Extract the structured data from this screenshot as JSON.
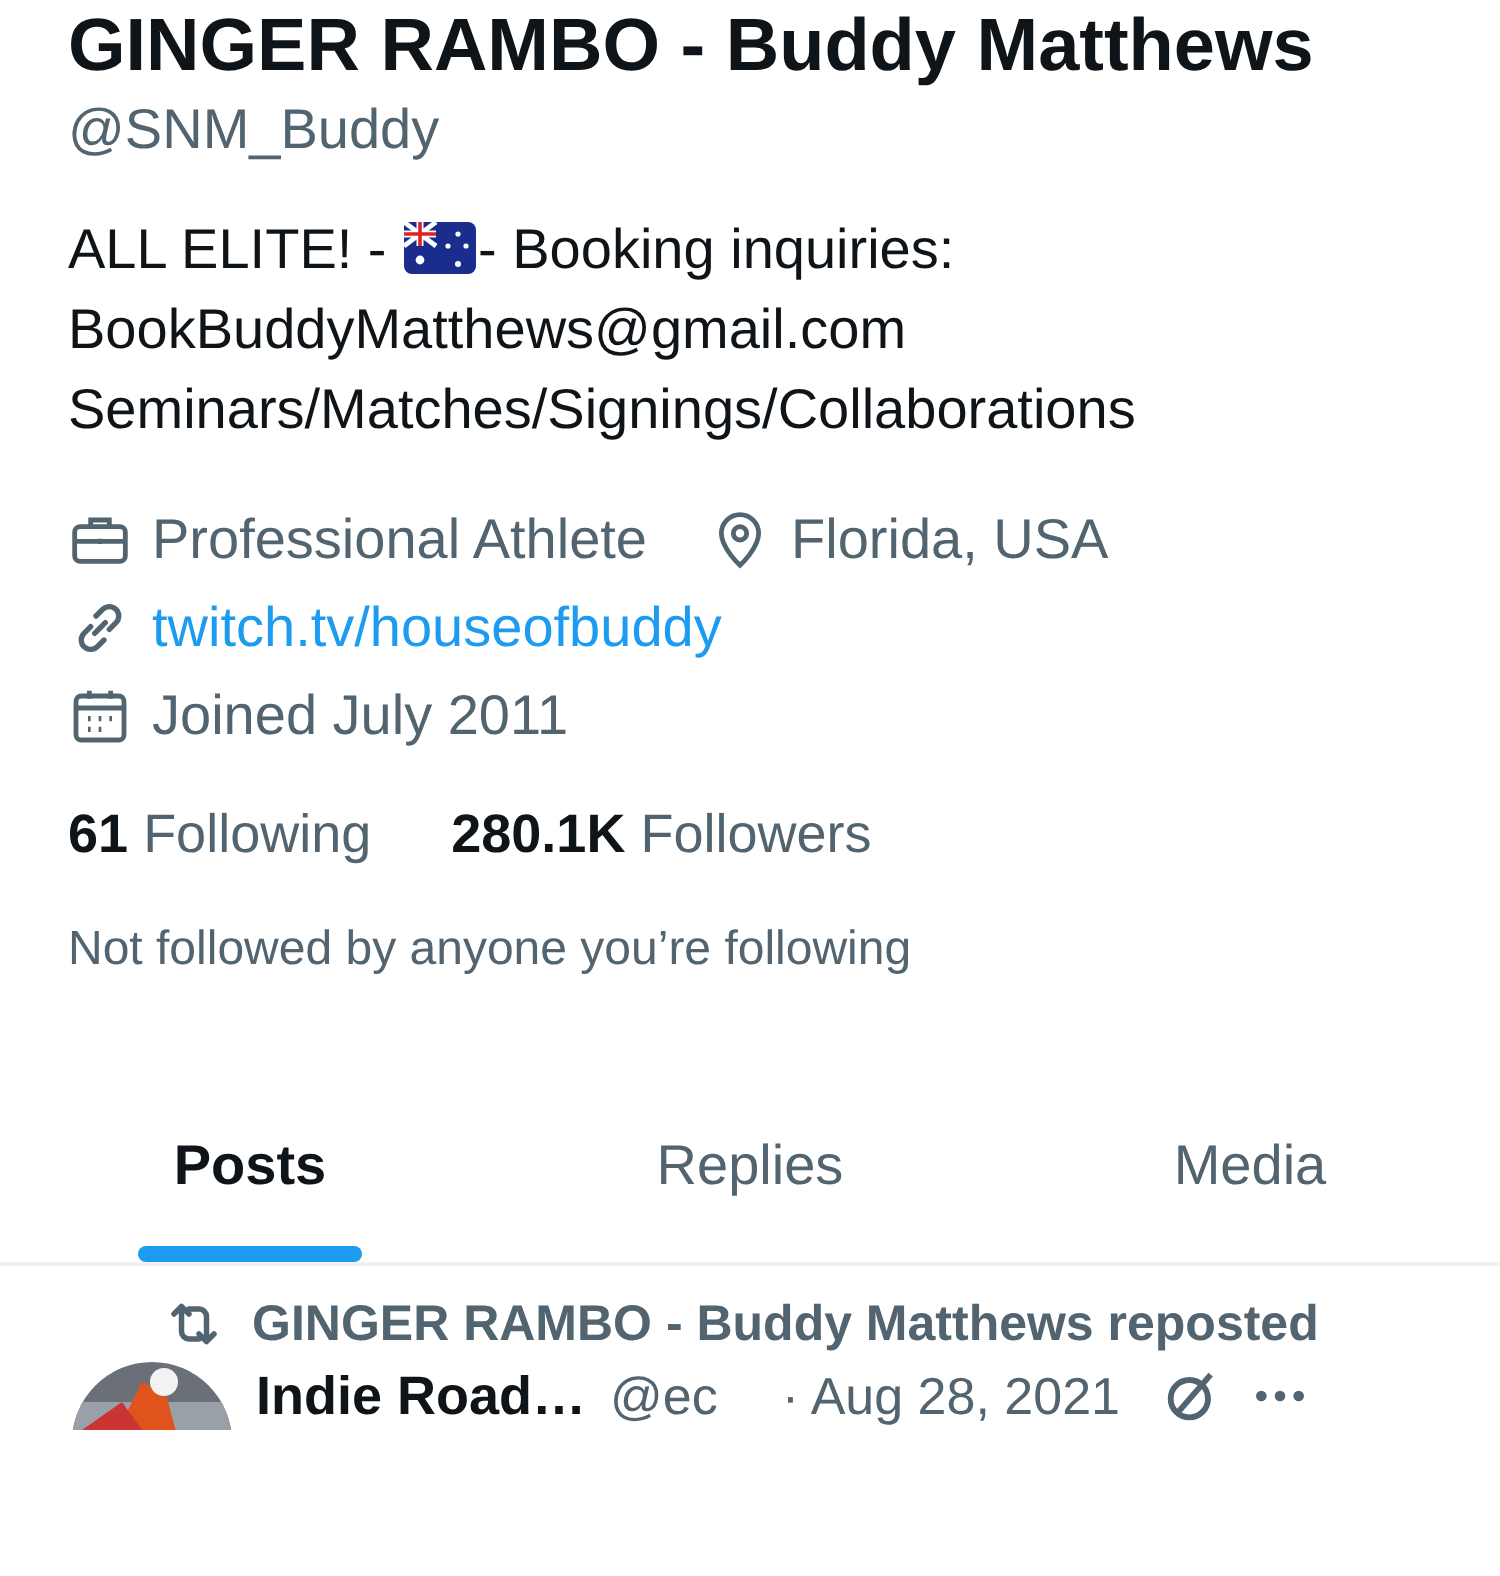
{
  "profile": {
    "name": "GINGER RAMBO - Buddy Matthews",
    "handle": "@SNM_Buddy",
    "bio": [
      {
        "kind": "text",
        "text": "ALL ELITE! - "
      },
      {
        "kind": "flag"
      },
      {
        "kind": "text",
        "text": "- Booking inquiries: BookBuddyMatthews@gmail.com Seminars/Matches/Signings/Collaborations"
      }
    ],
    "category": "Professional Athlete",
    "location": "Florida, USA",
    "website": "twitch.tv/houseofbuddy",
    "joined": "Joined July 2011",
    "following": {
      "count": "61",
      "label": "Following"
    },
    "followers": {
      "count": "280.1K",
      "label": "Followers"
    },
    "followed_by": "Not followed by anyone you’re following"
  },
  "tabs": [
    {
      "label": "Posts",
      "selected": true
    },
    {
      "label": "Replies",
      "selected": false
    },
    {
      "label": "Media",
      "selected": false
    }
  ],
  "post": {
    "repost_note": "GINGER RAMBO - Buddy Matthews reposted",
    "author": "Indie Road…",
    "handle": "@ec",
    "date": "· Aug 28, 2021"
  }
}
